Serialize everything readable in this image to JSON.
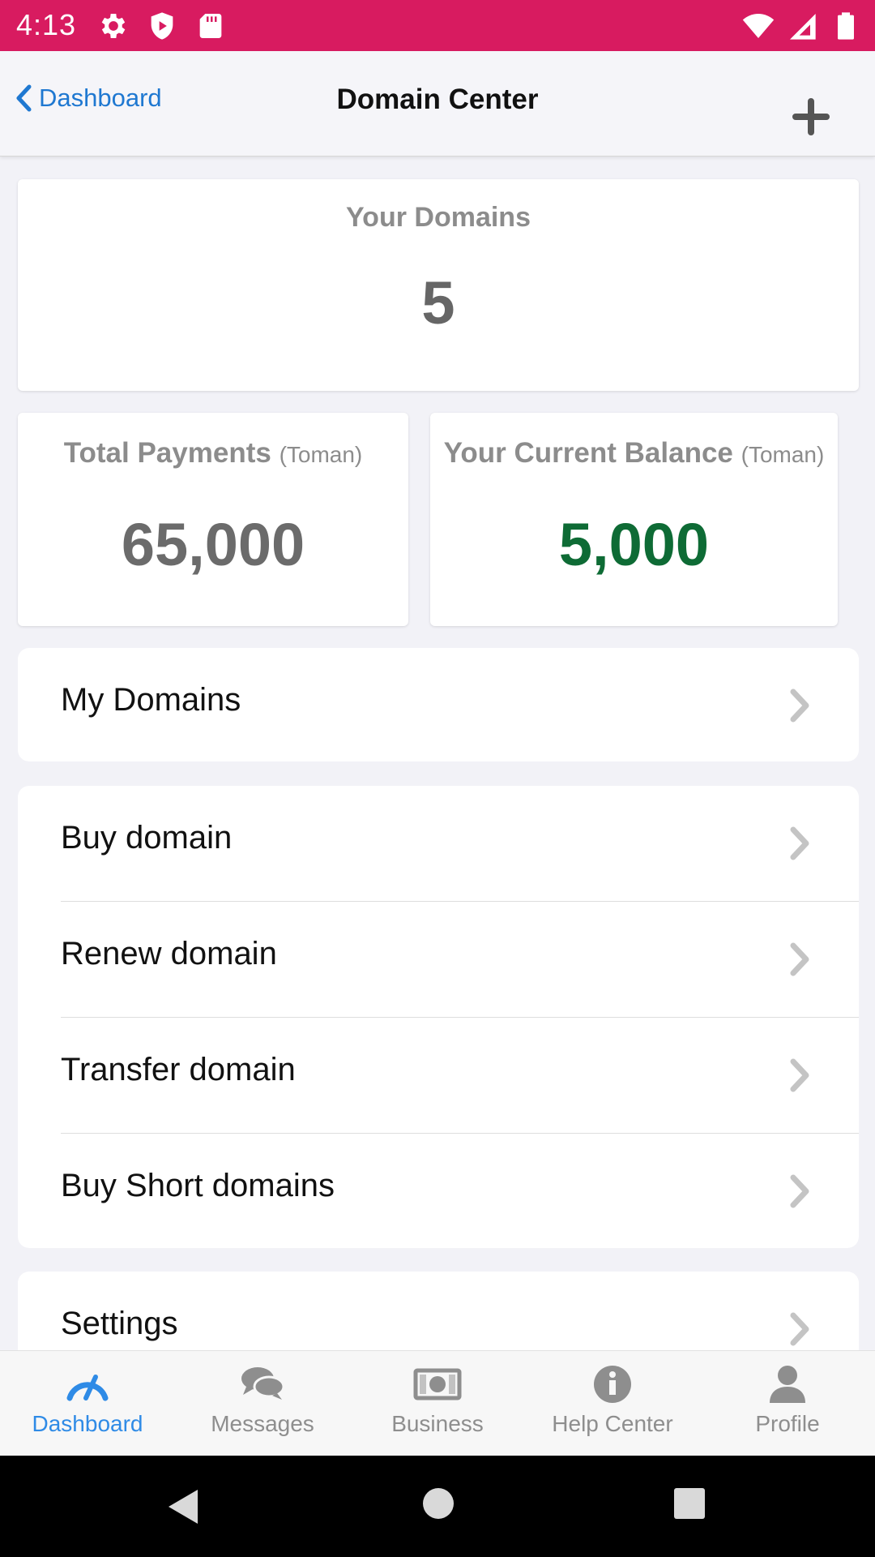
{
  "status_bar": {
    "time": "4:13"
  },
  "nav": {
    "back_label": "Dashboard",
    "title": "Domain Center"
  },
  "summary": {
    "domains_label": "Your Domains",
    "domains_value": "5",
    "payments_label": "Total Payments",
    "payments_unit": "(Toman)",
    "payments_value": "65,000",
    "balance_label": "Your Current Balance",
    "balance_unit": "(Toman)",
    "balance_value": "5,000"
  },
  "lists": {
    "my_domains": "My Domains",
    "actions": [
      "Buy domain",
      "Renew domain",
      "Transfer domain",
      "Buy Short domains"
    ],
    "settings": "Settings"
  },
  "tabs": [
    "Dashboard",
    "Messages",
    "Business",
    "Help Center",
    "Profile"
  ],
  "colors": {
    "status_bar": "#d81b60",
    "accent": "#2f8be6",
    "balance": "#0e6b35"
  }
}
